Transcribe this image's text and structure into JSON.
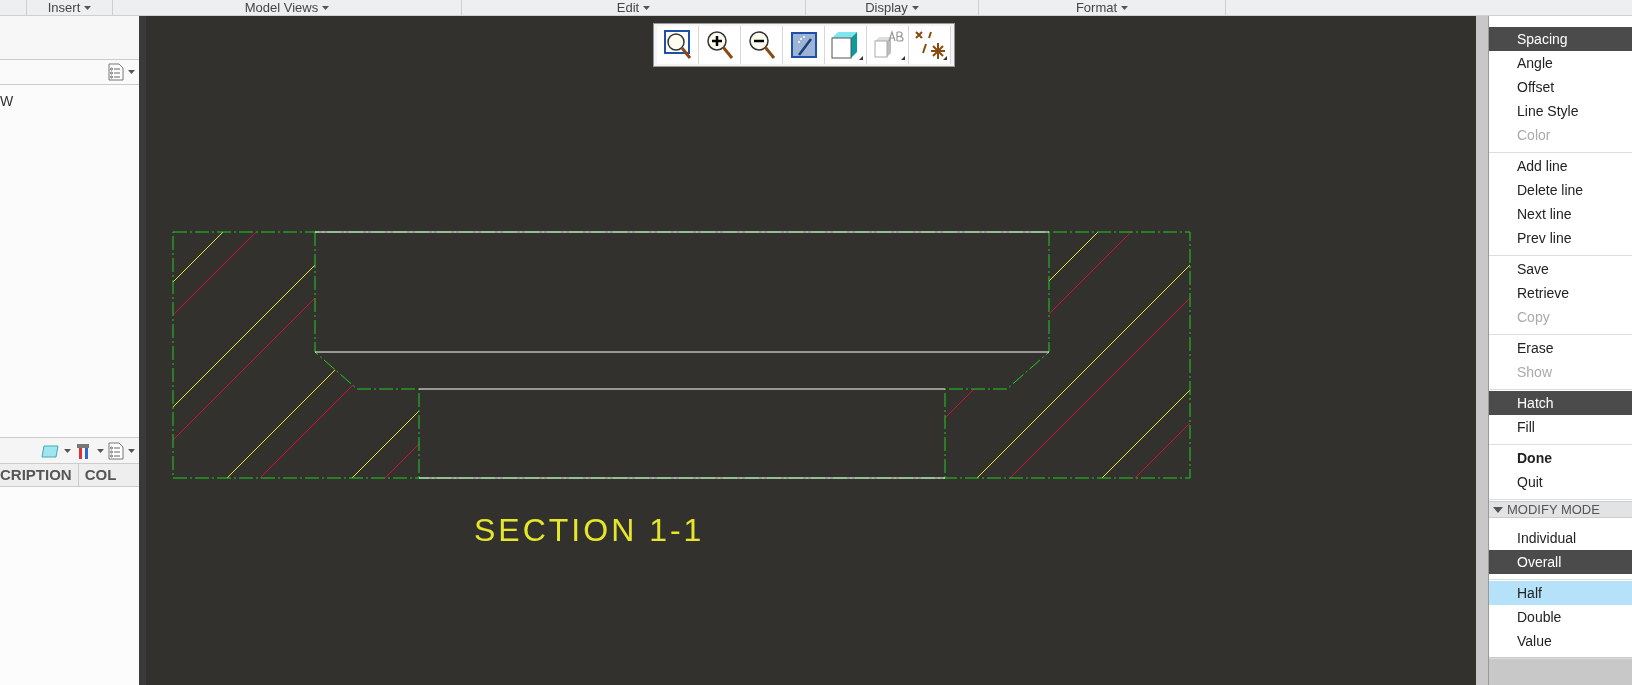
{
  "ribbon": {
    "groups": [
      "Insert",
      "Model Views",
      "Edit",
      "Display",
      "Format"
    ]
  },
  "model_tree": {
    "items": [
      "W"
    ]
  },
  "layer_table": {
    "columns": [
      "CRIPTION",
      "COL"
    ]
  },
  "canvas": {
    "toolbar": [
      {
        "kind": "zoom_fit"
      },
      {
        "kind": "zoom_in"
      },
      {
        "kind": "zoom_out"
      },
      {
        "kind": "repaint"
      },
      {
        "kind": "shade"
      },
      {
        "kind": "annotation"
      },
      {
        "kind": "datum"
      }
    ],
    "section_label": "SECTION 1-1"
  },
  "menu": {
    "groups": [
      {
        "items": [
          {
            "label": "Spacing",
            "selected": true,
            "disabled": false,
            "default": false
          },
          {
            "label": "Angle",
            "selected": false,
            "disabled": false,
            "default": false
          },
          {
            "label": "Offset",
            "selected": false,
            "disabled": false,
            "default": false
          },
          {
            "label": "Line Style",
            "selected": false,
            "disabled": false,
            "default": false
          },
          {
            "label": "Color",
            "selected": false,
            "disabled": true,
            "default": false
          }
        ]
      },
      {
        "items": [
          {
            "label": "Add line",
            "selected": false,
            "disabled": false,
            "default": false
          },
          {
            "label": "Delete line",
            "selected": false,
            "disabled": false,
            "default": false
          },
          {
            "label": "Next line",
            "selected": false,
            "disabled": false,
            "default": false
          },
          {
            "label": "Prev line",
            "selected": false,
            "disabled": false,
            "default": false
          }
        ]
      },
      {
        "items": [
          {
            "label": "Save",
            "selected": false,
            "disabled": false,
            "default": false
          },
          {
            "label": "Retrieve",
            "selected": false,
            "disabled": false,
            "default": false
          },
          {
            "label": "Copy",
            "selected": false,
            "disabled": true,
            "default": false
          }
        ]
      },
      {
        "items": [
          {
            "label": "Erase",
            "selected": false,
            "disabled": false,
            "default": false
          },
          {
            "label": "Show",
            "selected": false,
            "disabled": true,
            "default": false
          }
        ]
      },
      {
        "items": [
          {
            "label": "Hatch",
            "selected": true,
            "disabled": false,
            "default": false
          },
          {
            "label": "Fill",
            "selected": false,
            "disabled": false,
            "default": false
          }
        ]
      },
      {
        "items": [
          {
            "label": "Done",
            "selected": false,
            "disabled": false,
            "default": true
          },
          {
            "label": "Quit",
            "selected": false,
            "disabled": false,
            "default": false
          }
        ]
      }
    ],
    "section": {
      "title": "MODIFY MODE",
      "expanded": true,
      "groups": [
        {
          "items": [
            {
              "label": "Individual",
              "selected": false,
              "disabled": false,
              "default": false
            },
            {
              "label": "Overall",
              "selected": true,
              "disabled": false,
              "default": false
            }
          ]
        },
        {
          "kind": "light",
          "items": [
            {
              "label": "Half",
              "selected": true,
              "disabled": false,
              "default": false
            },
            {
              "label": "Double",
              "selected": false,
              "disabled": false,
              "default": false
            },
            {
              "label": "Value",
              "selected": false,
              "disabled": false,
              "default": false
            }
          ]
        }
      ]
    }
  }
}
